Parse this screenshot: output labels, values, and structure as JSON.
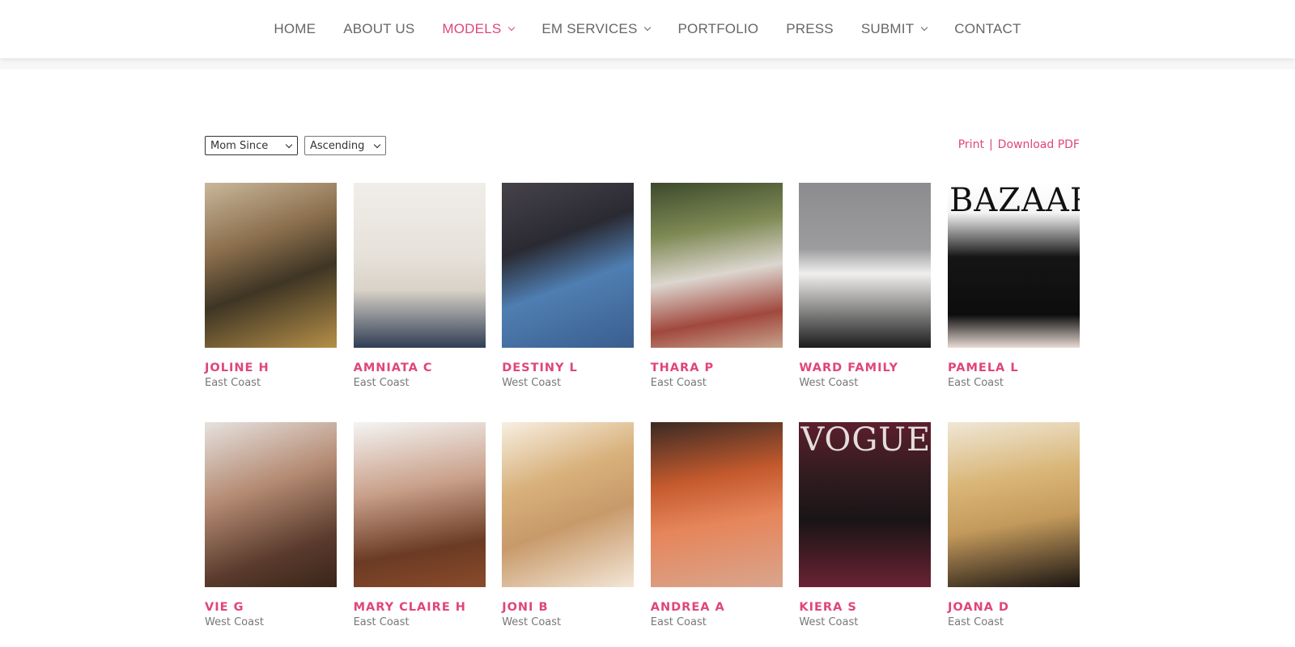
{
  "nav": {
    "items": [
      {
        "label": "HOME",
        "active": false,
        "dropdown": false
      },
      {
        "label": "ABOUT US",
        "active": false,
        "dropdown": false
      },
      {
        "label": "MODELS",
        "active": true,
        "dropdown": true
      },
      {
        "label": "EM SERVICES",
        "active": false,
        "dropdown": true
      },
      {
        "label": "PORTFOLIO",
        "active": false,
        "dropdown": false
      },
      {
        "label": "PRESS",
        "active": false,
        "dropdown": false
      },
      {
        "label": "SUBMIT",
        "active": false,
        "dropdown": true
      },
      {
        "label": "CONTACT",
        "active": false,
        "dropdown": false
      }
    ]
  },
  "filters": {
    "sort_by": "Mom Since",
    "order": "Ascending"
  },
  "actions": {
    "print": "Print",
    "separator": "|",
    "download": "Download PDF"
  },
  "colors": {
    "accent": "#e0457b",
    "nav_text": "#666666",
    "meta_text": "#777777"
  },
  "models": [
    {
      "name": "JOLINE H",
      "region": "East Coast",
      "photo": "linear-gradient(160deg,#c9b79b 0%,#8a6e4c 35%,#3e3524 60%,#b58f48 100%)"
    },
    {
      "name": "AMNIATA C",
      "region": "East Coast",
      "photo": "linear-gradient(180deg,#f0eeea 0%,#e6e1d9 45%,#d8d2c8 65%,#2f3d55 100%)"
    },
    {
      "name": "DESTINY L",
      "region": "West Coast",
      "photo": "linear-gradient(160deg,#46424a 0%,#2a2a32 35%,#4f7eb2 60%,#3a5e8e 100%)"
    },
    {
      "name": "THARA P",
      "region": "East Coast",
      "photo": "linear-gradient(170deg,#3d4a2c 0%,#7f8a55 30%,#dcd6cf 55%,#a1483d 80%,#c7a38d 100%)"
    },
    {
      "name": "WARD FAMILY",
      "region": "West Coast",
      "photo": "linear-gradient(180deg,#8c8c8e 0%,#9c9c9f 40%,#f0efee 55%,#1c1c1c 100%)"
    },
    {
      "name": "PAMELA L",
      "region": "East Coast",
      "photo": "linear-gradient(180deg,#ffffff 0%,#f5f5f5 18%,#151515 45%,#0d0d0d 80%,#e9dbd4 100%)",
      "mag": "BAZAAR",
      "mag_light": false
    },
    {
      "name": "VIE G",
      "region": "West Coast",
      "photo": "linear-gradient(160deg,#e6e2df 0%,#b48a72 40%,#5a3b2d 75%,#3a2519 100%)"
    },
    {
      "name": "MARY CLAIRE H",
      "region": "East Coast",
      "photo": "linear-gradient(170deg,#f4f4f3 0%,#c9a08a 40%,#6b3b24 75%,#8a4a2b 100%)"
    },
    {
      "name": "JONI B",
      "region": "West Coast",
      "photo": "linear-gradient(160deg,#f7efe2 0%,#d8b07a 35%,#c89a6a 60%,#f3e6d7 100%)"
    },
    {
      "name": "ANDREA A",
      "region": "East Coast",
      "photo": "linear-gradient(170deg,#3a2a24 0%,#c45a2d 35%,#e6855a 60%,#d9a58d 100%)"
    },
    {
      "name": "KIERA S",
      "region": "West Coast",
      "photo": "linear-gradient(180deg,#5c1f2c 0%,#2d1b1f 35%,#1a1416 60%,#6a2334 100%)",
      "mag": "VOGUE",
      "mag_light": true
    },
    {
      "name": "JOANA D",
      "region": "East Coast",
      "photo": "linear-gradient(170deg,#efe7d6 0%,#d9b678 35%,#c49a5c 60%,#1b1512 100%)"
    }
  ]
}
